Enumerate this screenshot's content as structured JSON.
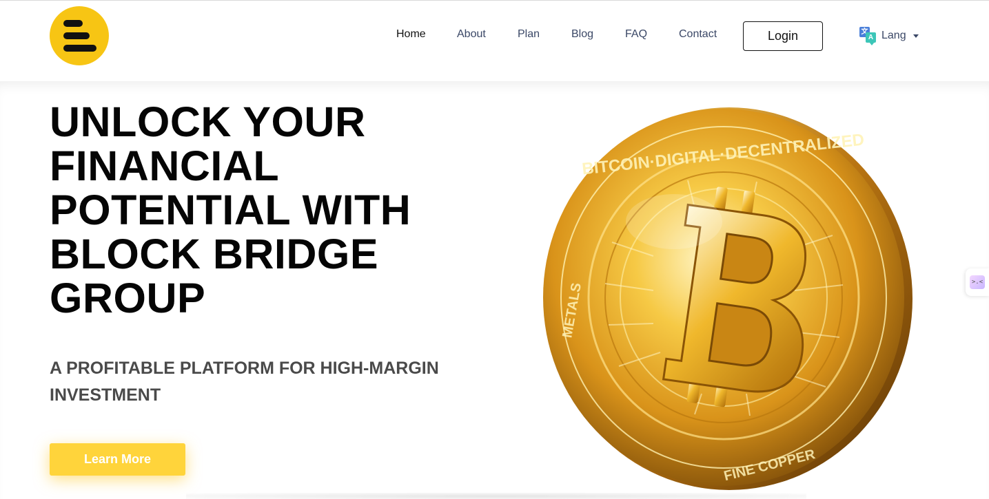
{
  "header": {
    "logo": {
      "name": "block-bridge-logo",
      "color": "#f7c514"
    },
    "nav": [
      {
        "id": "home",
        "label": "Home",
        "active": true
      },
      {
        "id": "about",
        "label": "About"
      },
      {
        "id": "plan",
        "label": "Plan"
      },
      {
        "id": "blog",
        "label": "Blog"
      },
      {
        "id": "faq",
        "label": "FAQ"
      },
      {
        "id": "contact",
        "label": "Contact"
      }
    ],
    "login_label": "Login",
    "lang": {
      "label": "Lang",
      "icon": "translate-icon"
    }
  },
  "hero": {
    "headline": "UNLOCK YOUR FINANCIAL POTENTIAL WITH BLOCK BRIDGE GROUP",
    "subheadline": "A PROFITABLE PLATFORM FOR HIGH-MARGIN INVESTMENT",
    "cta_label": "Learn More",
    "image": "bitcoin-coin-image",
    "coin_ring_text": "BITCOIN·DIGITAL·DECENTRALIZED",
    "coin_metal_text": "METALS",
    "coin_bottom_text": "FINE COPPER"
  },
  "colors": {
    "accent_yellow": "#ffd43b",
    "logo_yellow": "#f7c514",
    "nav_text": "#3a4766",
    "headline_text": "#050505",
    "subhead_text": "#4a4a4a"
  },
  "side_widget": {
    "icon": "widget-face-icon",
    "glyph": ">.<"
  }
}
